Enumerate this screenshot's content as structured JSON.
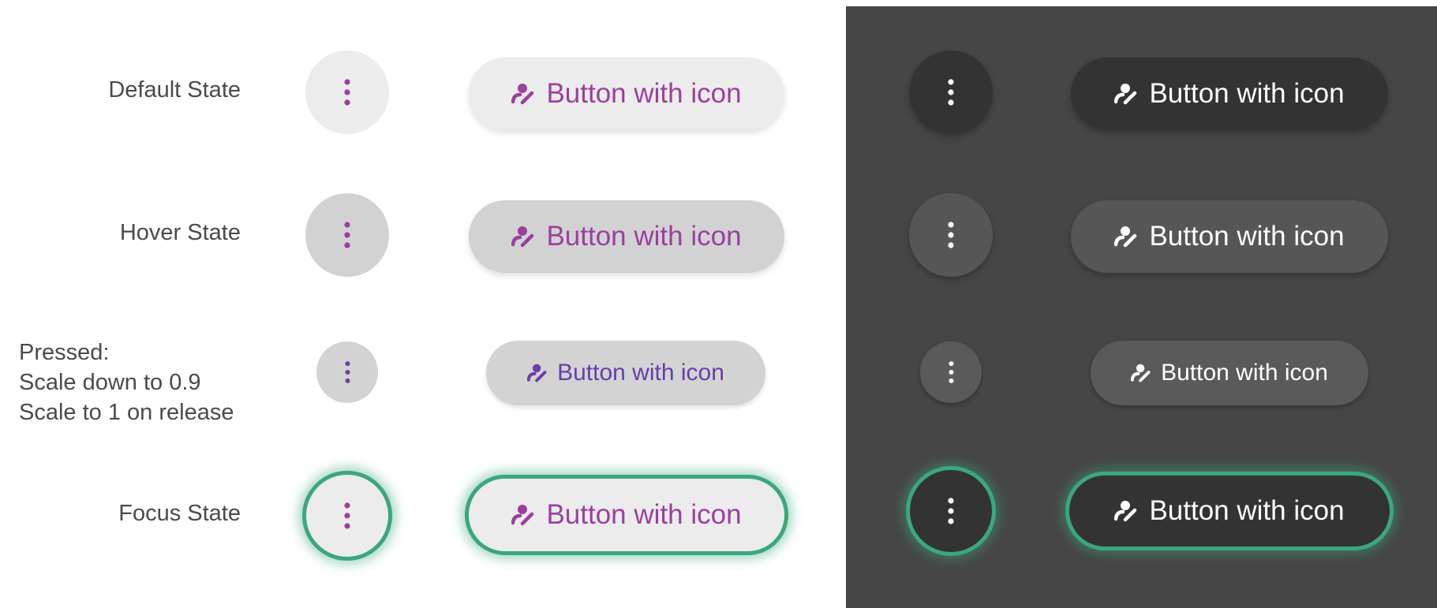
{
  "colors": {
    "light_text": "#9b3fa0",
    "light_pressed_text": "#6a3da8",
    "dark_text": "#ffffff",
    "focus_ring": "#3ba77d",
    "dark_panel": "#464646"
  },
  "icons": {
    "menu": "more-vert-icon",
    "pill": "person-edit-icon"
  },
  "rows": [
    {
      "id": "default",
      "label_lines": [
        "Default State"
      ]
    },
    {
      "id": "hover",
      "label_lines": [
        "Hover State"
      ]
    },
    {
      "id": "pressed",
      "label_lines": [
        "Pressed:",
        "Scale down to 0.9",
        "Scale to 1 on release"
      ]
    },
    {
      "id": "focus",
      "label_lines": [
        "Focus State"
      ]
    }
  ],
  "button_label": "Button with icon"
}
